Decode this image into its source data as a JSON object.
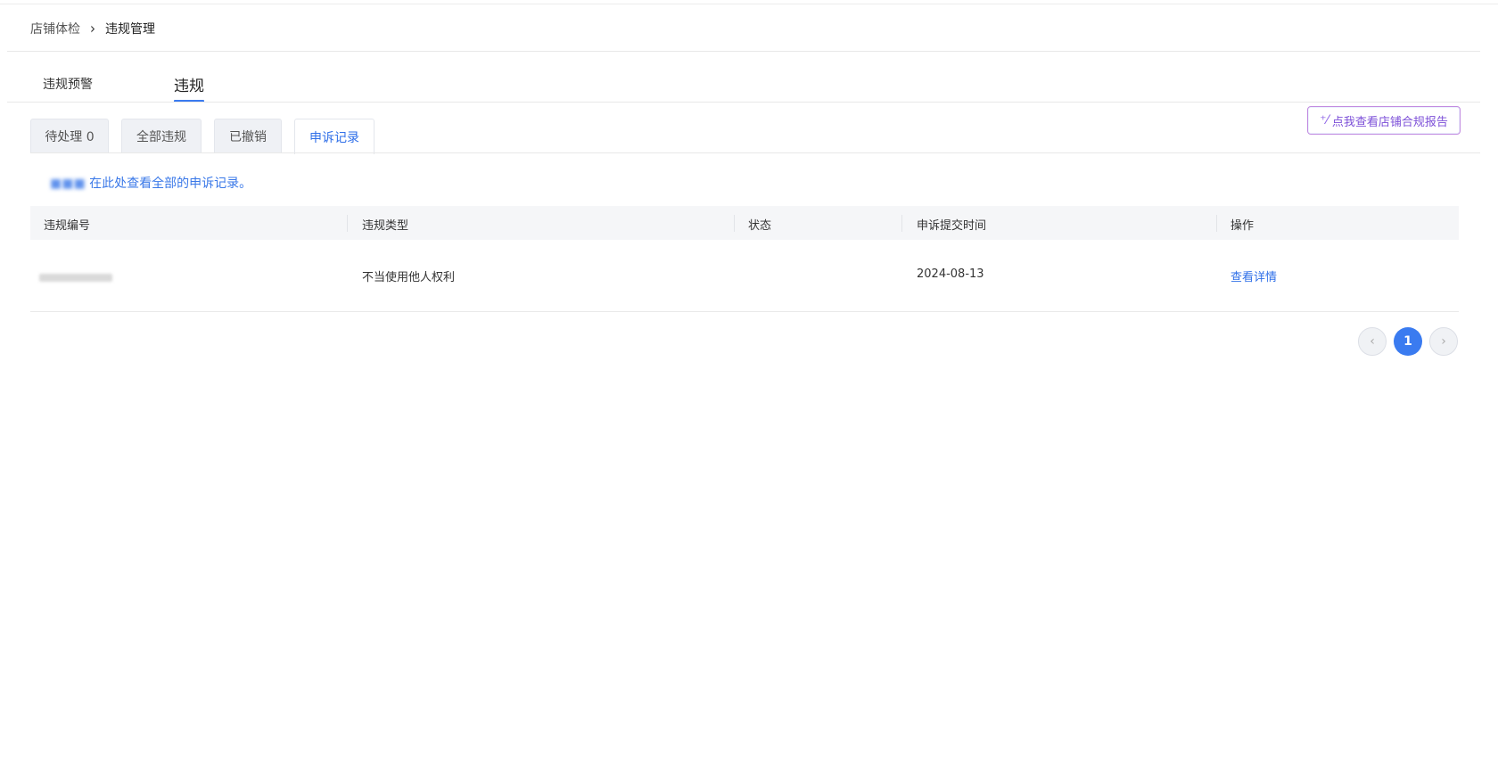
{
  "breadcrumb": {
    "parent": "店铺体检",
    "separator": "›",
    "current": "违规管理"
  },
  "main_tabs": [
    {
      "label": "违规预警"
    },
    {
      "label": "违规"
    }
  ],
  "sub_tabs": [
    {
      "label": "待处理 0"
    },
    {
      "label": "全部违规"
    },
    {
      "label": "已撤销"
    },
    {
      "label": "申诉记录"
    }
  ],
  "active_sub_tab": "申诉记录",
  "report_button": {
    "label": "点我查看店铺合规报告",
    "icon": "sparkle-wand-icon"
  },
  "notice": {
    "text": "在此处查看全部的申诉记录。"
  },
  "table": {
    "columns": [
      "违规编号",
      "违规类型",
      "状态",
      "申诉提交时间",
      "操作"
    ],
    "rows": [
      {
        "id": "",
        "type": "不当使用他人权利",
        "status": "",
        "submit_time": "2024-08-13",
        "action": "查看详情"
      }
    ]
  },
  "pagination": {
    "current_page": "1",
    "prev_icon": "chevron-left-icon",
    "next_icon": "chevron-right-icon"
  },
  "colors": {
    "accent": "#3a7bf0",
    "link": "#2f6fe8",
    "report_border": "#c28be0"
  }
}
